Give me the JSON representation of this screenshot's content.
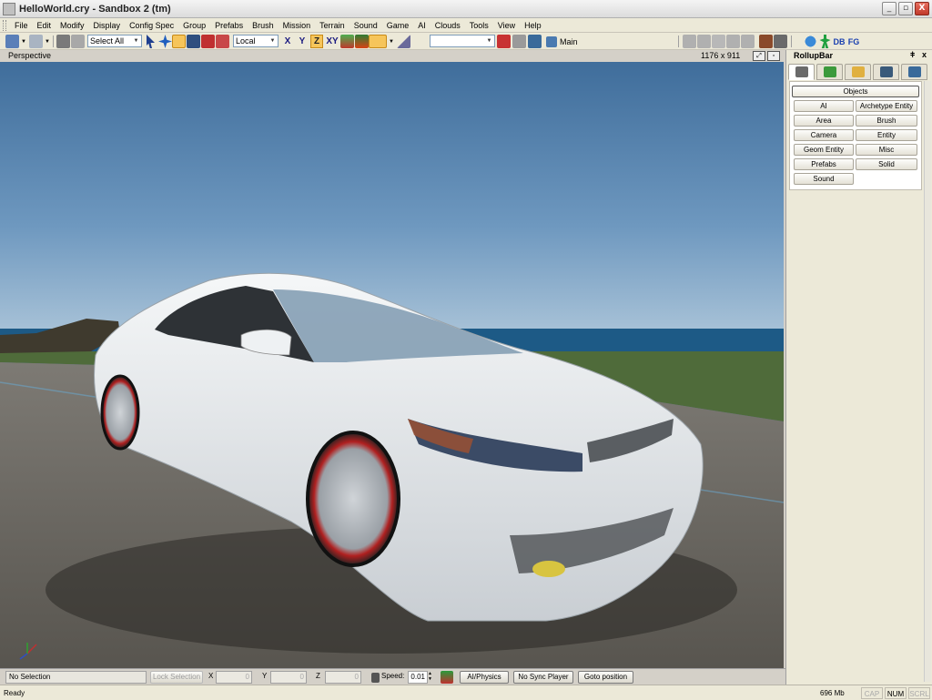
{
  "window": {
    "title": "HelloWorld.cry - Sandbox 2 (tm)",
    "min": "_",
    "max": "▫",
    "close": "X"
  },
  "menu": [
    "File",
    "Edit",
    "Modify",
    "Display",
    "Config Spec",
    "Group",
    "Prefabs",
    "Brush",
    "Mission",
    "Terrain",
    "Sound",
    "Game",
    "AI",
    "Clouds",
    "Tools",
    "View",
    "Help"
  ],
  "toolbar": {
    "selection_combo": "Select All",
    "coord_combo": "Local",
    "axes": {
      "x": "X",
      "y": "Y",
      "z": "Z",
      "xy": "XY"
    },
    "layer_label": "Main",
    "db_label": "DB",
    "fg_label": "FG"
  },
  "viewport": {
    "title": "Perspective",
    "resolution": "1176 x 911"
  },
  "rollup": {
    "title": "RollupBar",
    "pin": "ǂ",
    "close": "x",
    "objects_header": "Objects",
    "buttons": [
      "AI",
      "Archetype Entity",
      "Area",
      "Brush",
      "Camera",
      "Entity",
      "Geom Entity",
      "Misc",
      "Prefabs",
      "Solid",
      "Sound"
    ]
  },
  "bottom": {
    "selection": "No Selection",
    "lock_selection": "Lock Selection",
    "x_label": "X",
    "y_label": "Y",
    "z_label": "Z",
    "x_value": "0",
    "y_value": "0",
    "z_value": "0",
    "speed_label": "Speed:",
    "speed_value": "0.01",
    "ai_physics": "AI/Physics",
    "no_sync_player": "No Sync Player",
    "goto_position": "Goto position"
  },
  "status": {
    "text": "Ready",
    "memory": "696 Mb",
    "cap": "CAP",
    "num": "NUM",
    "scrl": "SCRL"
  },
  "colors": {
    "sky": "#4a79a6",
    "ground": "#6e6b65",
    "car": "#e8ecef",
    "accent": "#f6c55a"
  }
}
